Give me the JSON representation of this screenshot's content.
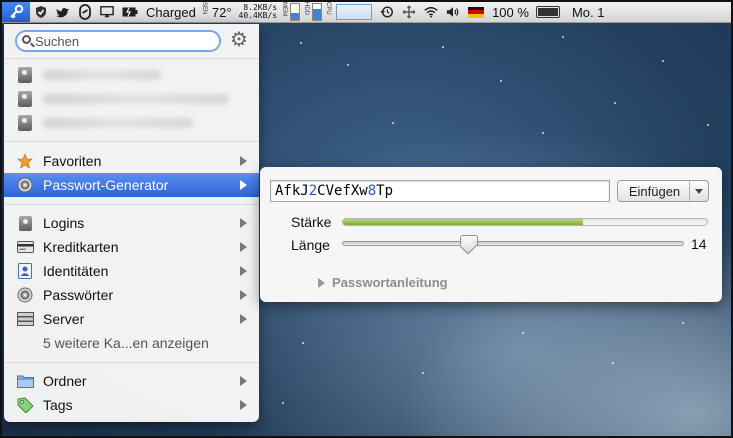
{
  "menubar": {
    "temperature": "72°",
    "battery_status": "Charged",
    "net_up": "8.2KB/s",
    "net_down": "40.4KB/s",
    "sensor_label": "SEN",
    "mem_label": "MEM",
    "hdd_label": "HDD",
    "cpu_label": "CPU",
    "battery_percent": "100 %",
    "clock": "Mo. 1",
    "colors": {
      "key_accent": "#2f6fe0"
    }
  },
  "search": {
    "placeholder": "Suchen"
  },
  "recent_logins": [
    {
      "label": "blurred login 1"
    },
    {
      "label": "blurred login 2"
    },
    {
      "label": "blurred login 3"
    }
  ],
  "menu": {
    "favorites": "Favoriten",
    "password_generator": "Passwort-Generator",
    "logins": "Logins",
    "credit_cards": "Kreditkarten",
    "identities": "Identitäten",
    "passwords": "Passwörter",
    "servers": "Server",
    "more_categories": "5 weitere Ka...en anzeigen",
    "folders": "Ordner",
    "tags": "Tags"
  },
  "generator": {
    "password_segments": [
      {
        "text": "AfkJ",
        "digit": false
      },
      {
        "text": "2",
        "digit": true
      },
      {
        "text": "CVefXw",
        "digit": false
      },
      {
        "text": "8",
        "digit": true
      },
      {
        "text": "Tp",
        "digit": false
      }
    ],
    "insert_button": "Einfügen",
    "strength_label": "Stärke",
    "strength_value": 0.66,
    "length_label": "Länge",
    "length_value": 14,
    "length_fraction": 0.37,
    "guide_label": "Passwortanleitung",
    "colors": {
      "digit": "#2c54c9",
      "strength": "#8fbb3d"
    }
  }
}
